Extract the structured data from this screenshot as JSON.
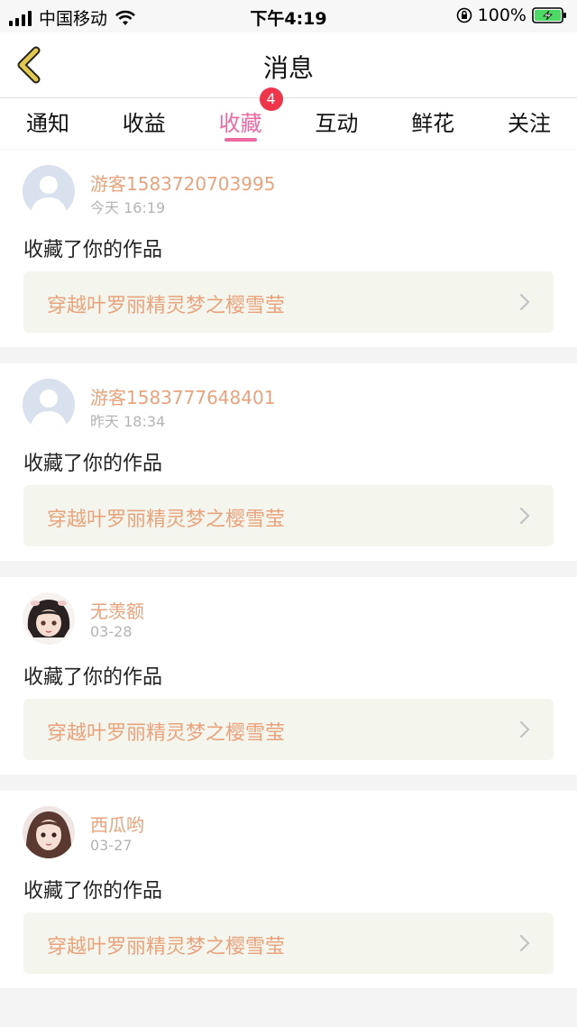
{
  "status_bar": {
    "carrier": "中国移动",
    "time": "下午4:19",
    "battery": "100%",
    "icons": [
      "signal-icon",
      "wifi-icon",
      "orientation-lock-icon",
      "battery-charging-icon"
    ]
  },
  "header": {
    "title": "消息",
    "back_icon": "chevron-left-icon",
    "accent": "#e3c94a"
  },
  "tabs": [
    {
      "label": "通知"
    },
    {
      "label": "收益"
    },
    {
      "label": "收藏",
      "active": true,
      "badge": "4"
    },
    {
      "label": "互动"
    },
    {
      "label": "鲜花"
    },
    {
      "label": "关注"
    }
  ],
  "colors": {
    "active_tab": "#ec6aa0",
    "badge": "#f0344a",
    "username": "#e9a37c",
    "work_bg": "#f4f5ed"
  },
  "items": [
    {
      "username": "游客1583720703995",
      "time": "今天 16:19",
      "action": "收藏了你的作品",
      "work": "穿越叶罗丽精灵梦之樱雪莹",
      "avatar": "default-avatar"
    },
    {
      "username": "游客1583777648401",
      "time": "昨天 18:34",
      "action": "收藏了你的作品",
      "work": "穿越叶罗丽精灵梦之樱雪莹",
      "avatar": "default-avatar"
    },
    {
      "username": "无羡额",
      "time": "03-28",
      "action": "收藏了你的作品",
      "work": "穿越叶罗丽精灵梦之樱雪莹",
      "avatar": "anime-girl-avatar"
    },
    {
      "username": "西瓜哟",
      "time": "03-27",
      "action": "收藏了你的作品",
      "work": "穿越叶罗丽精灵梦之樱雪莹",
      "avatar": "girl-portrait-avatar"
    }
  ]
}
